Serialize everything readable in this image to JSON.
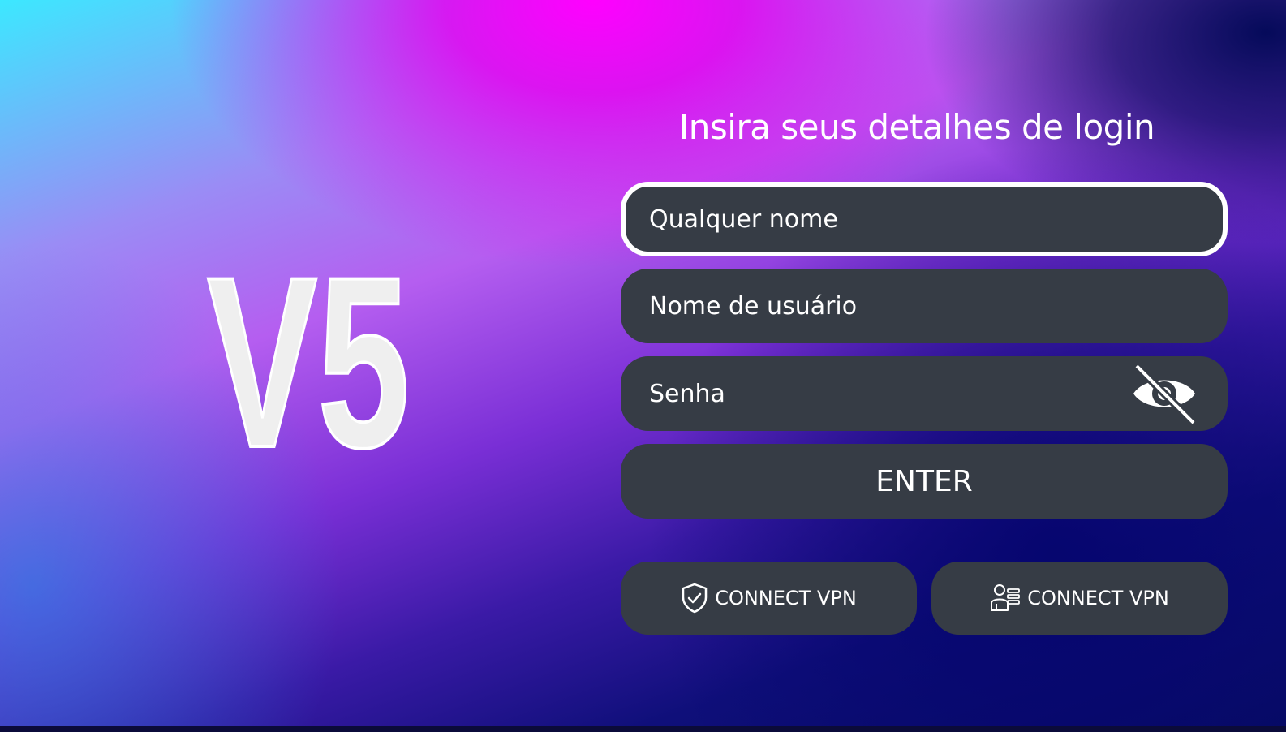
{
  "logo": {
    "text": "V5"
  },
  "login": {
    "title": "Insira seus detalhes de login",
    "any_name_placeholder": "Qualquer nome",
    "username_placeholder": "Nome de usuário",
    "password_placeholder": "Senha",
    "enter_label": "ENTER"
  },
  "vpn": {
    "button1_label": "CONNECT VPN",
    "button1_icon": "shield-check-icon",
    "button2_label": "CONNECT VPN",
    "button2_icon": "user-list-icon"
  },
  "colors": {
    "field_bg": "#363c45",
    "text": "#ffffff",
    "logo_fill": "#efefef"
  }
}
